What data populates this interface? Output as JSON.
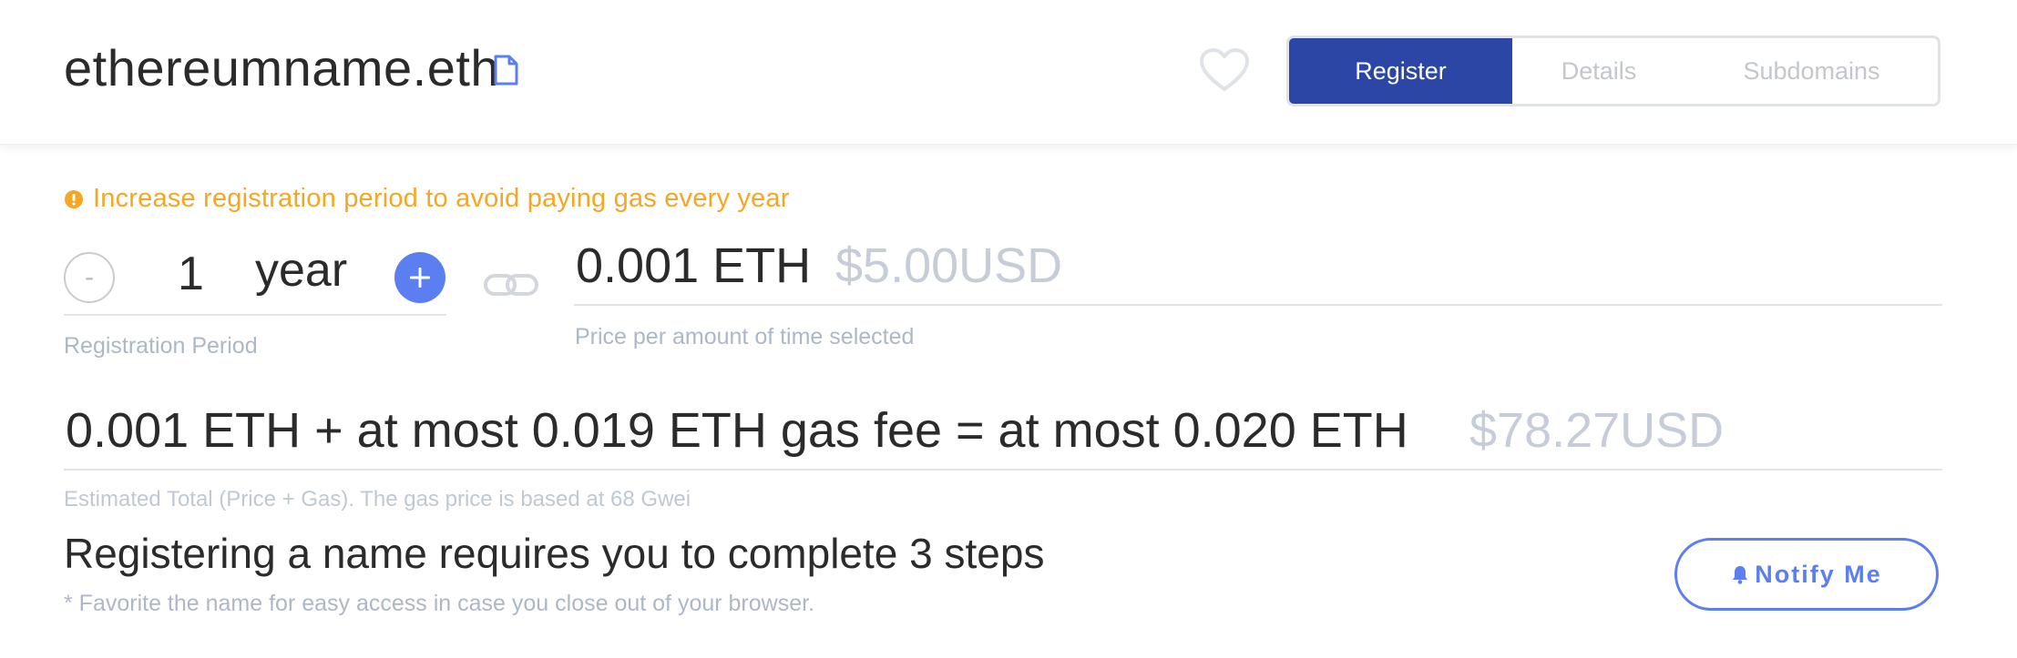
{
  "header": {
    "domain_name": "ethereumname.eth",
    "icons": {
      "copy": "copy-document-icon",
      "favorite": "heart-icon"
    },
    "tabs": [
      {
        "label": "Register",
        "active": true
      },
      {
        "label": "Details",
        "active": false
      },
      {
        "label": "Subdomains",
        "active": false
      }
    ]
  },
  "warning": {
    "icon": "exclamation-circle-icon",
    "text": "Increase registration period to avoid paying gas every year"
  },
  "registration": {
    "decrement_label": "-",
    "years": "1",
    "unit": "year",
    "increment_icon": "plus-icon",
    "label": "Registration Period",
    "link_icon": "chain-link-icon"
  },
  "price": {
    "eth": "0.001 ETH",
    "usd": "$5.00USD",
    "label": "Price per amount of time selected"
  },
  "total": {
    "text": "0.001 ETH + at most 0.019 ETH gas fee = at most 0.020 ETH",
    "usd": "$78.27USD",
    "label": "Estimated Total (Price + Gas). The gas price is based at 68 Gwei"
  },
  "steps": {
    "title": "Registering a name requires you to complete 3 steps",
    "note": "* Favorite the name for easy access in case you close out of your browser.",
    "notify_label": "Notify Me",
    "notify_icon": "bell-icon"
  },
  "colors": {
    "primary": "#2c46a6",
    "accent": "#5b7ff0",
    "warning": "#f5a623",
    "muted": "#adb8c7"
  }
}
